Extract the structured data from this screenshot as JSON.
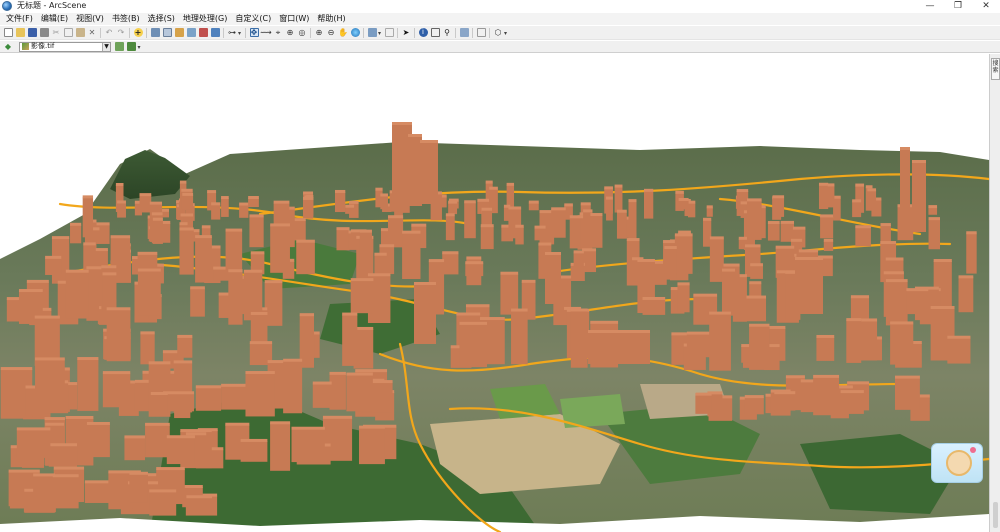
{
  "window": {
    "title": "无标题 - ArcScene",
    "controls": {
      "minimize": "—",
      "maximize": "❐",
      "close": "✕"
    }
  },
  "menu": {
    "items": [
      "文件(F)",
      "编辑(E)",
      "视图(V)",
      "书签(B)",
      "选择(S)",
      "地理处理(G)",
      "自定义(C)",
      "窗口(W)",
      "帮助(H)"
    ]
  },
  "toolbar": {
    "standard_icons": [
      "new-icon",
      "open-icon",
      "save-icon",
      "print-icon",
      "cut-icon",
      "copy-icon",
      "paste-icon",
      "delete-icon",
      "undo-icon",
      "redo-icon",
      "add-data-icon"
    ],
    "view_icons": [
      "arccatalog-icon",
      "toc-icon",
      "layer-props-icon",
      "scene-props-icon",
      "animation-icon",
      "layer-icon"
    ],
    "navigate_icons": [
      "navigate-icon",
      "fly-icon",
      "target-center-icon",
      "zoom-to-target-icon",
      "set-observer-icon",
      "zoom-in-icon",
      "zoom-out-icon",
      "pan-icon",
      "full-extent-icon",
      "select-features-icon",
      "clear-selection-icon",
      "select-elements-icon",
      "identify-icon",
      "html-popup-icon",
      "find-icon",
      "measure-icon",
      "globe-icon"
    ]
  },
  "layer_bar": {
    "selected_layer": "影像.tif"
  },
  "side_panel": {
    "tab_label": "搜索"
  },
  "colors": {
    "building": "#c77a54",
    "building_roof": "#d68b63",
    "road": "#f2a71b",
    "vegetation": "#3f6b34",
    "bare_ground": "#c7b48a"
  }
}
